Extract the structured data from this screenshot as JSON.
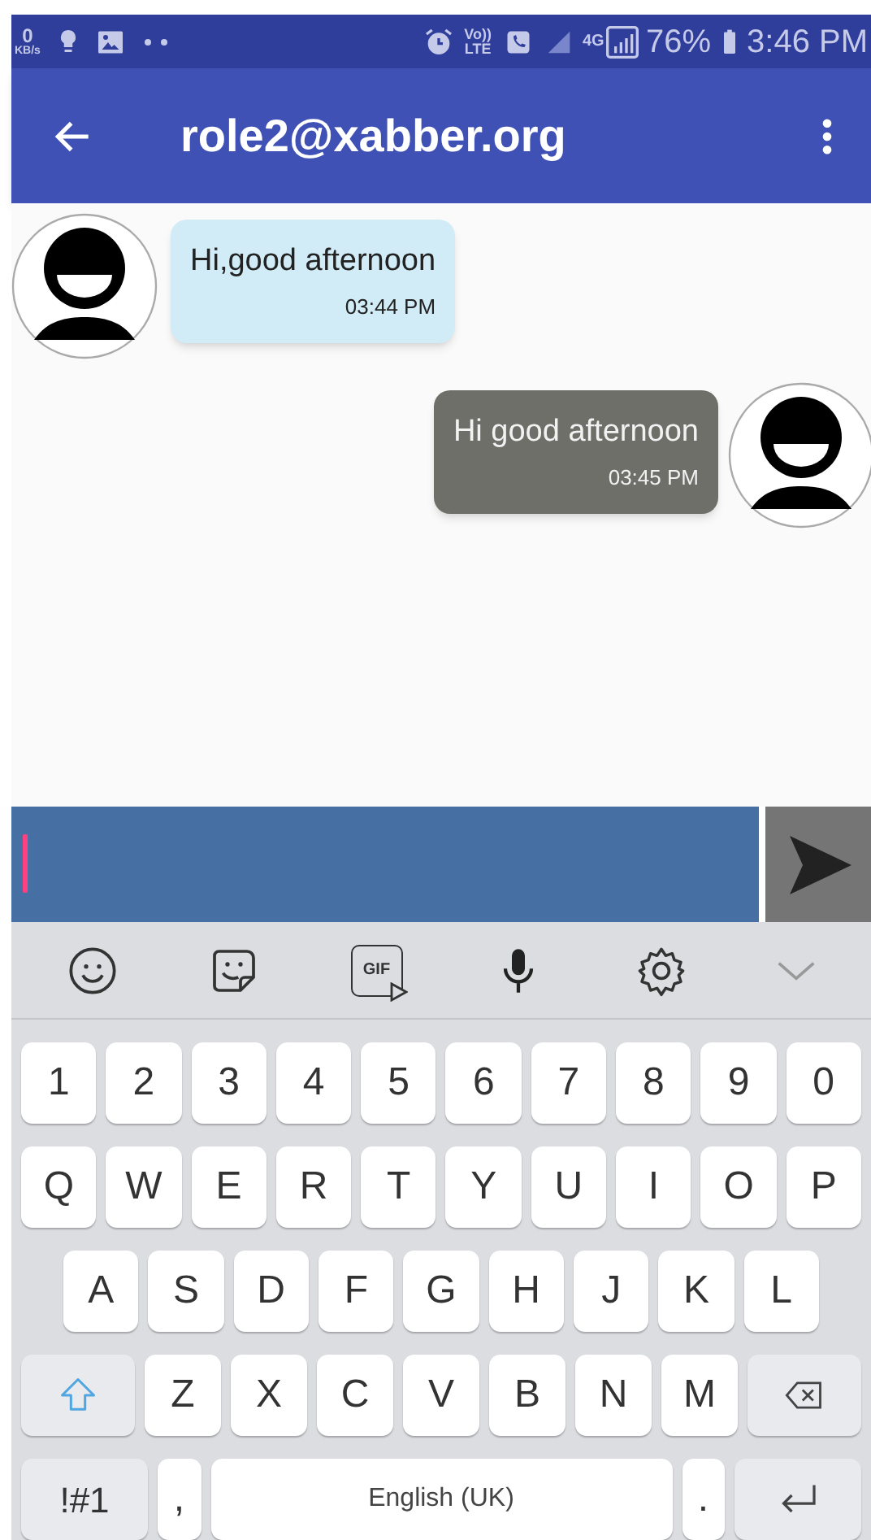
{
  "status_bar": {
    "speed_value": "0",
    "speed_unit": "KB/s",
    "volte_top": "Vo))",
    "volte_bottom": "LTE",
    "network": "4G",
    "battery": "76%",
    "time": "3:46 PM"
  },
  "app_bar": {
    "title": "role2@xabber.org"
  },
  "messages": [
    {
      "kind": "incoming",
      "text": "Hi,good afternoon",
      "time": "03:44 PM"
    },
    {
      "kind": "outgoing",
      "text": "Hi good afternoon",
      "time": "03:45 PM"
    }
  ],
  "keyboard": {
    "toolbar": [
      {
        "kind": "emoji"
      },
      {
        "kind": "sticker"
      },
      {
        "kind": "gif",
        "label": "GIF"
      },
      {
        "kind": "mic"
      },
      {
        "kind": "settings"
      },
      {
        "kind": "collapse"
      }
    ],
    "rows": [
      {
        "keys": [
          {
            "kind": "char",
            "label": "1"
          },
          {
            "kind": "char",
            "label": "2"
          },
          {
            "kind": "char",
            "label": "3"
          },
          {
            "kind": "char",
            "label": "4"
          },
          {
            "kind": "char",
            "label": "5"
          },
          {
            "kind": "char",
            "label": "6"
          },
          {
            "kind": "char",
            "label": "7"
          },
          {
            "kind": "char",
            "label": "8"
          },
          {
            "kind": "char",
            "label": "9"
          },
          {
            "kind": "char",
            "label": "0"
          }
        ]
      },
      {
        "keys": [
          {
            "kind": "char",
            "label": "Q"
          },
          {
            "kind": "char",
            "label": "W"
          },
          {
            "kind": "char",
            "label": "E"
          },
          {
            "kind": "char",
            "label": "R"
          },
          {
            "kind": "char",
            "label": "T"
          },
          {
            "kind": "char",
            "label": "Y"
          },
          {
            "kind": "char",
            "label": "U"
          },
          {
            "kind": "char",
            "label": "I"
          },
          {
            "kind": "char",
            "label": "O"
          },
          {
            "kind": "char",
            "label": "P"
          }
        ]
      },
      {
        "keys": [
          {
            "kind": "char",
            "label": "A"
          },
          {
            "kind": "char",
            "label": "S"
          },
          {
            "kind": "char",
            "label": "D"
          },
          {
            "kind": "char",
            "label": "F"
          },
          {
            "kind": "char",
            "label": "G"
          },
          {
            "kind": "char",
            "label": "H"
          },
          {
            "kind": "char",
            "label": "J"
          },
          {
            "kind": "char",
            "label": "K"
          },
          {
            "kind": "char",
            "label": "L"
          }
        ]
      },
      {
        "keys": [
          {
            "kind": "shift"
          },
          {
            "kind": "char",
            "label": "Z"
          },
          {
            "kind": "char",
            "label": "X"
          },
          {
            "kind": "char",
            "label": "C"
          },
          {
            "kind": "char",
            "label": "V"
          },
          {
            "kind": "char",
            "label": "B"
          },
          {
            "kind": "char",
            "label": "N"
          },
          {
            "kind": "char",
            "label": "M"
          },
          {
            "kind": "backspace"
          }
        ]
      },
      {
        "keys": [
          {
            "kind": "symbols",
            "label": "!#1"
          },
          {
            "kind": "char",
            "label": ","
          },
          {
            "kind": "space",
            "label": "English (UK)"
          },
          {
            "kind": "char",
            "label": "."
          },
          {
            "kind": "enter"
          }
        ]
      }
    ]
  }
}
